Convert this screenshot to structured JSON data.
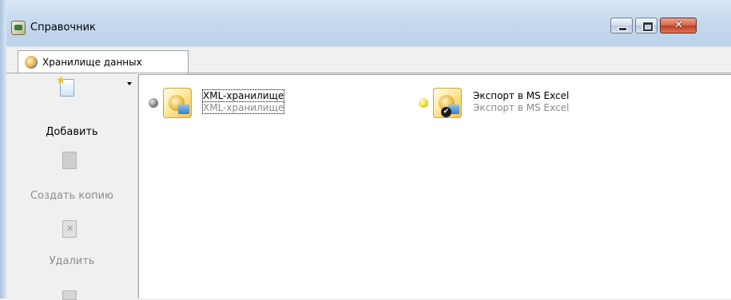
{
  "window": {
    "title": "Справочник",
    "controls": {
      "minimize": "minimize",
      "maximize": "maximize",
      "close": "✕"
    }
  },
  "tabs": [
    {
      "label": "Хранилище данных",
      "icon": "database-icon",
      "selected": true
    }
  ],
  "toolbar": {
    "add_label": "Добавить",
    "copy_label": "Создать копию",
    "delete_label": "Удалить"
  },
  "items": [
    {
      "title": "XML-хранилище",
      "subtitle": "XML-хранилище",
      "status": "gray",
      "status_color": "#7d7d7d",
      "icon": "storage-folder-icon",
      "default": false,
      "focused": true
    },
    {
      "title": "Экспорт в MS Excel",
      "subtitle": "Экспорт в MS Excel",
      "status": "yellow",
      "status_color": "#e8dc30",
      "icon": "storage-folder-icon",
      "default": true,
      "focused": false
    }
  ]
}
